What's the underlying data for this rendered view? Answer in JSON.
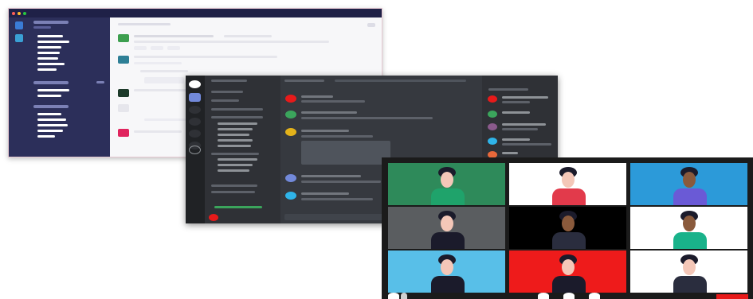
{
  "screenshot": {
    "windows": [
      {
        "name": "light-chat-window",
        "theme": "light",
        "sidebar_color": "#2c2f5a"
      },
      {
        "name": "dark-chat-window",
        "theme": "dark",
        "background_color": "#36393f"
      },
      {
        "name": "video-call-window",
        "grid": "3x3"
      }
    ],
    "colors": {
      "light_sidebar": "#2c2f5a",
      "dark_bg": "#36393f",
      "dark_rail": "#202225",
      "accent_blurple": "#7289da",
      "accent_green": "#3ba55c",
      "accent_red": "#e81a1a"
    },
    "video_tiles": [
      {
        "bg": "#2e8a5a",
        "shirt": "#1fa36b",
        "skin": "#f4c7b8",
        "hair": "#1b1b2b"
      },
      {
        "bg": "#ffffff",
        "shirt": "#e23a4b",
        "skin": "#f4c7b8",
        "hair": "#1b1b2b"
      },
      {
        "bg": "#2c9ad9",
        "shirt": "#6a5ad6",
        "skin": "#8a5a3c",
        "hair": "#1b1b2b"
      },
      {
        "bg": "#5a5d60",
        "shirt": "#1b1b2b",
        "skin": "#f4c7b8",
        "hair": "#1b1b2b"
      },
      {
        "bg": "#000000",
        "shirt": "#2a2d3e",
        "skin": "#8a5a3c",
        "hair": "#1b1b2b"
      },
      {
        "bg": "#ffffff",
        "shirt": "#19b28a",
        "skin": "#8a5a3c",
        "hair": "#1b1b2b"
      },
      {
        "bg": "#58bfe8",
        "shirt": "#1b1b2b",
        "skin": "#f4c7b8",
        "hair": "#1b1b2b"
      },
      {
        "bg": "#ee1b1b",
        "shirt": "#1b1b2b",
        "skin": "#f4c7b8",
        "hair": "#1b1b2b"
      },
      {
        "bg": "#ffffff",
        "shirt": "#2a2d3e",
        "skin": "#f4c7b8",
        "hair": "#1b1b2b"
      }
    ],
    "icons": [
      "window-close-dot-icon",
      "window-minimize-dot-icon",
      "window-maximize-dot-icon",
      "user-avatar-icon",
      "server-icon",
      "mic-icon",
      "camera-icon",
      "end-call-icon"
    ]
  }
}
